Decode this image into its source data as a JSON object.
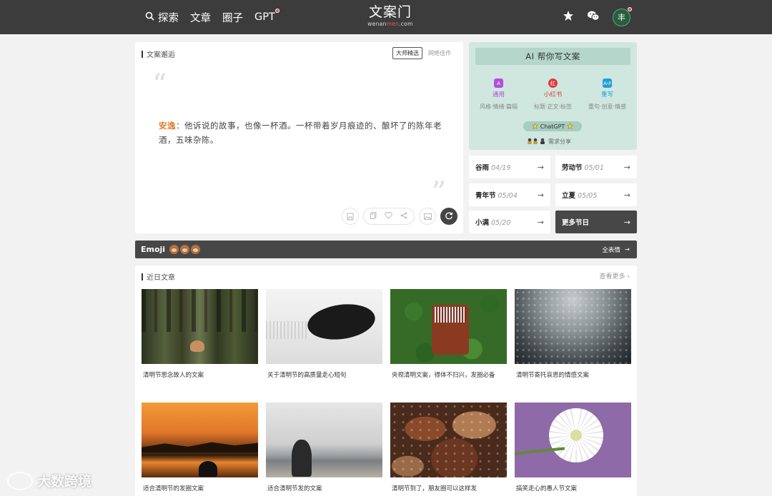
{
  "nav": {
    "items": [
      {
        "label": "探索",
        "icon": "search-icon"
      },
      {
        "label": "文章"
      },
      {
        "label": "圈子"
      },
      {
        "label": "GPT",
        "badge": true
      }
    ]
  },
  "logo": {
    "title": "文案门",
    "sub_pre": "wenan",
    "sub_hl": "men",
    "sub_post": ".com"
  },
  "header_right": {
    "star_icon": "star-icon",
    "wechat_icon": "wechat-icon",
    "avatar_text": "丰"
  },
  "quote_card": {
    "title": "文案邂逅",
    "tabs": [
      "大师精选",
      "网络佳作"
    ],
    "author": "安逸：",
    "text": "他诉说的故事，也像一杯酒。一杯带着岁月痕迹的、酿坏了的陈年老酒，五味杂陈。",
    "open_mark": "“",
    "close_mark": "”"
  },
  "ai_card": {
    "title": "AI 帮你写文案",
    "options": [
      {
        "icon_text": "A",
        "label": "通用",
        "desc": "风格·情绪·篇幅",
        "color": "#b14fd8"
      },
      {
        "icon_text": "红",
        "label": "小红书",
        "desc": "标题·正文·标签",
        "color": "#e03a3a"
      },
      {
        "icon_text": "A↺",
        "label": "重写",
        "desc": "重句·创意·情感",
        "color": "#1f9fd6"
      }
    ],
    "gpt_label": "ChatGPT",
    "ask_label": "需求分享"
  },
  "festivals": [
    {
      "name": "谷雨",
      "date": "04/19"
    },
    {
      "name": "劳动节",
      "date": "05/01"
    },
    {
      "name": "青年节",
      "date": "05/04"
    },
    {
      "name": "立夏",
      "date": "05/05"
    },
    {
      "name": "小满",
      "date": "05/20"
    },
    {
      "name": "更多节日",
      "date": ""
    }
  ],
  "emoji_bar": {
    "title": "Emoji",
    "more": "全表情"
  },
  "articles": {
    "title": "近日文章",
    "more": "查看更多",
    "items": [
      {
        "caption": "清明节思念故人的文案"
      },
      {
        "caption": "关于清明节的高质量走心短句"
      },
      {
        "caption": "央视清明文案，得体不扫兴，发圈必备"
      },
      {
        "caption": "清明节寄托哀思的情感文案"
      },
      {
        "caption": "适合清明节的发圈文案"
      },
      {
        "caption": "适合清明节发的文案"
      },
      {
        "caption": "清明节到了，朋友圈可以这样发"
      },
      {
        "caption": "搞笑走心的愚人节文案"
      }
    ]
  },
  "watermark": {
    "text": "大数跨境"
  },
  "colors": {
    "topbar": "#3c3c3c",
    "ai_bg": "#cfe7df",
    "accent_author": "#e07a2a",
    "dark_tile": "#474747"
  }
}
